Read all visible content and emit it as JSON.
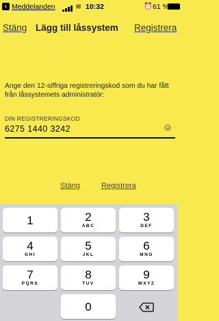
{
  "status": {
    "back_app": "Meddelanden",
    "time": "10:32",
    "battery": "61 %",
    "alarm_icon": "alarm-clock-icon",
    "wifi_icon": "wifi-icon",
    "signal_icon": "signal-bars-icon"
  },
  "nav": {
    "left": "Stäng",
    "title": "Lägg till låssystem",
    "right": "Registrera"
  },
  "form": {
    "instruction": "Ange den 12-siffriga registreringskod som du har fått från låssystemets administratör:",
    "field_label": "DIN REGISTRERINGSKOD",
    "field_value": "6275 1440 3242"
  },
  "actions": {
    "close": "Stäng",
    "register": "Registrera"
  },
  "keypad": {
    "keys": [
      {
        "num": "1",
        "letters": ""
      },
      {
        "num": "2",
        "letters": "ABC"
      },
      {
        "num": "3",
        "letters": "DEF"
      },
      {
        "num": "4",
        "letters": "GHI"
      },
      {
        "num": "5",
        "letters": "JKL"
      },
      {
        "num": "6",
        "letters": "MNO"
      },
      {
        "num": "7",
        "letters": "PQRS"
      },
      {
        "num": "8",
        "letters": "TUV"
      },
      {
        "num": "9",
        "letters": "WXYZ"
      },
      {
        "num": "0",
        "letters": ""
      }
    ]
  },
  "colors": {
    "background": "#f8ea4e",
    "keyboard": "#d3d3d8"
  }
}
